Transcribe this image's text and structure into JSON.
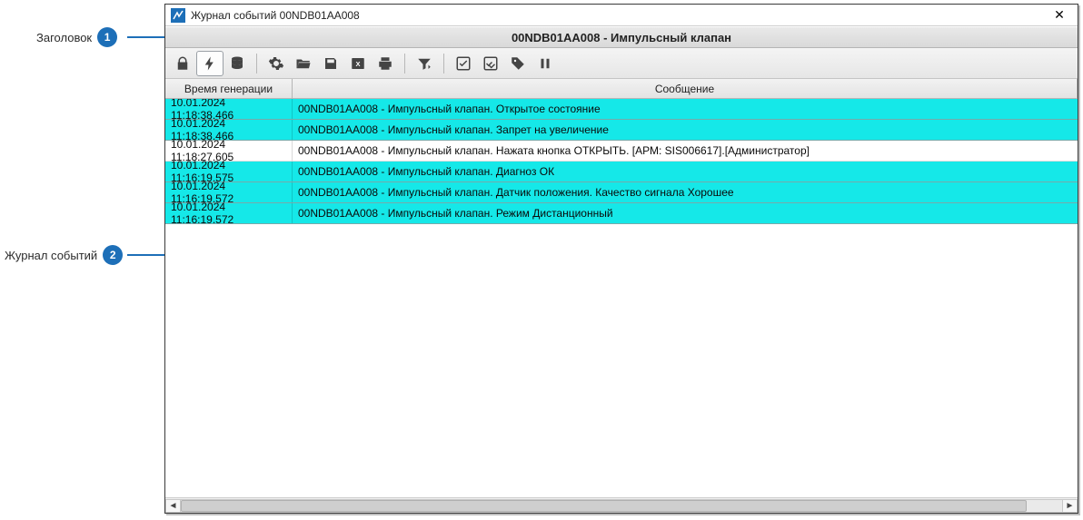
{
  "annotations": {
    "a1": {
      "label": "Заголовок",
      "num": "1"
    },
    "a2": {
      "label": "Журнал событий",
      "num": "2"
    }
  },
  "window": {
    "title": "Журнал событий 00NDB01AA008",
    "close": "✕"
  },
  "header": {
    "text": "00NDB01AA008 - Импульсный клапан"
  },
  "columns": {
    "time": "Время генерации",
    "msg": "Сообщение"
  },
  "rows": [
    {
      "hl": true,
      "time": "10.01.2024 11:18:38.466",
      "msg": "00NDB01AA008 - Импульсный клапан. Открытое состояние"
    },
    {
      "hl": true,
      "time": "10.01.2024 11:18:38.466",
      "msg": "00NDB01AA008 - Импульсный клапан. Запрет на увеличение"
    },
    {
      "hl": false,
      "time": "10.01.2024 11:18:27.605",
      "msg": "00NDB01AA008 - Импульсный клапан. Нажата кнопка ОТКРЫТЬ. [АРМ: SIS006617].[Администратор]"
    },
    {
      "hl": true,
      "time": "10.01.2024 11:16:19.575",
      "msg": "00NDB01AA008 - Импульсный клапан. Диагноз ОК"
    },
    {
      "hl": true,
      "time": "10.01.2024 11:16:19.572",
      "msg": "00NDB01AA008 - Импульсный клапан. Датчик положения. Качество сигнала Хорошее"
    },
    {
      "hl": true,
      "time": "10.01.2024 11:16:19.572",
      "msg": "00NDB01AA008 - Импульсный клапан. Режим Дистанционный"
    }
  ],
  "colors": {
    "highlight": "#15e8e8",
    "badge": "#1d6fb8"
  }
}
